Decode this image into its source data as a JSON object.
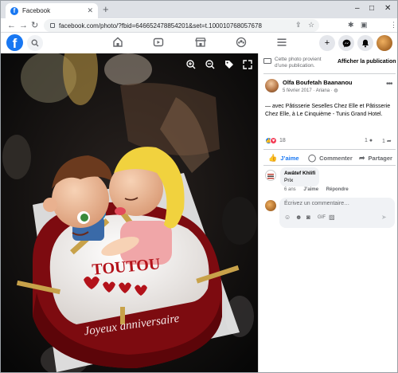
{
  "browser": {
    "tab_title": "Facebook",
    "url": "facebook.com/photo/?fbid=646652478854201&set=t.100010768057678",
    "window_controls": [
      "–",
      "□",
      "✕"
    ]
  },
  "fb": {
    "logo": "f",
    "nav_icons": [
      "home-icon",
      "watch-icon",
      "marketplace-icon",
      "groups-icon",
      "menu-icon"
    ],
    "actions": [
      "+",
      "messenger-icon",
      "bell-icon"
    ]
  },
  "photo": {
    "cake_text": "TOUTOU",
    "plate_text": "Joyeux anniversaire",
    "tools": [
      "zoom-in-icon",
      "zoom-out-icon",
      "tag-icon",
      "fullscreen-icon"
    ]
  },
  "panel": {
    "notice_text": "Cette photo provient d’une publication.",
    "notice_action": "Afficher la publication",
    "poster_name": "Olfa Boufetah Baananou",
    "poster_meta": "5 février 2017 · Ariana · ",
    "caption": "— avec Pâtisserie Seselles Chez Elle et Pâtisserie Chez Elle, à Le Cinquième - Tunis Grand Hotel.",
    "reaction_count": "18",
    "comment_count": "1",
    "share_count": "1",
    "like_label": "J’aime",
    "comment_label": "Commenter",
    "share_label": "Partager",
    "comment": {
      "author": "Awâtef Khlifi",
      "text": "Prix",
      "age": "6 ans",
      "like": "J’aime",
      "reply": "Répondre"
    },
    "input_placeholder": "Écrivez un commentaire…"
  }
}
